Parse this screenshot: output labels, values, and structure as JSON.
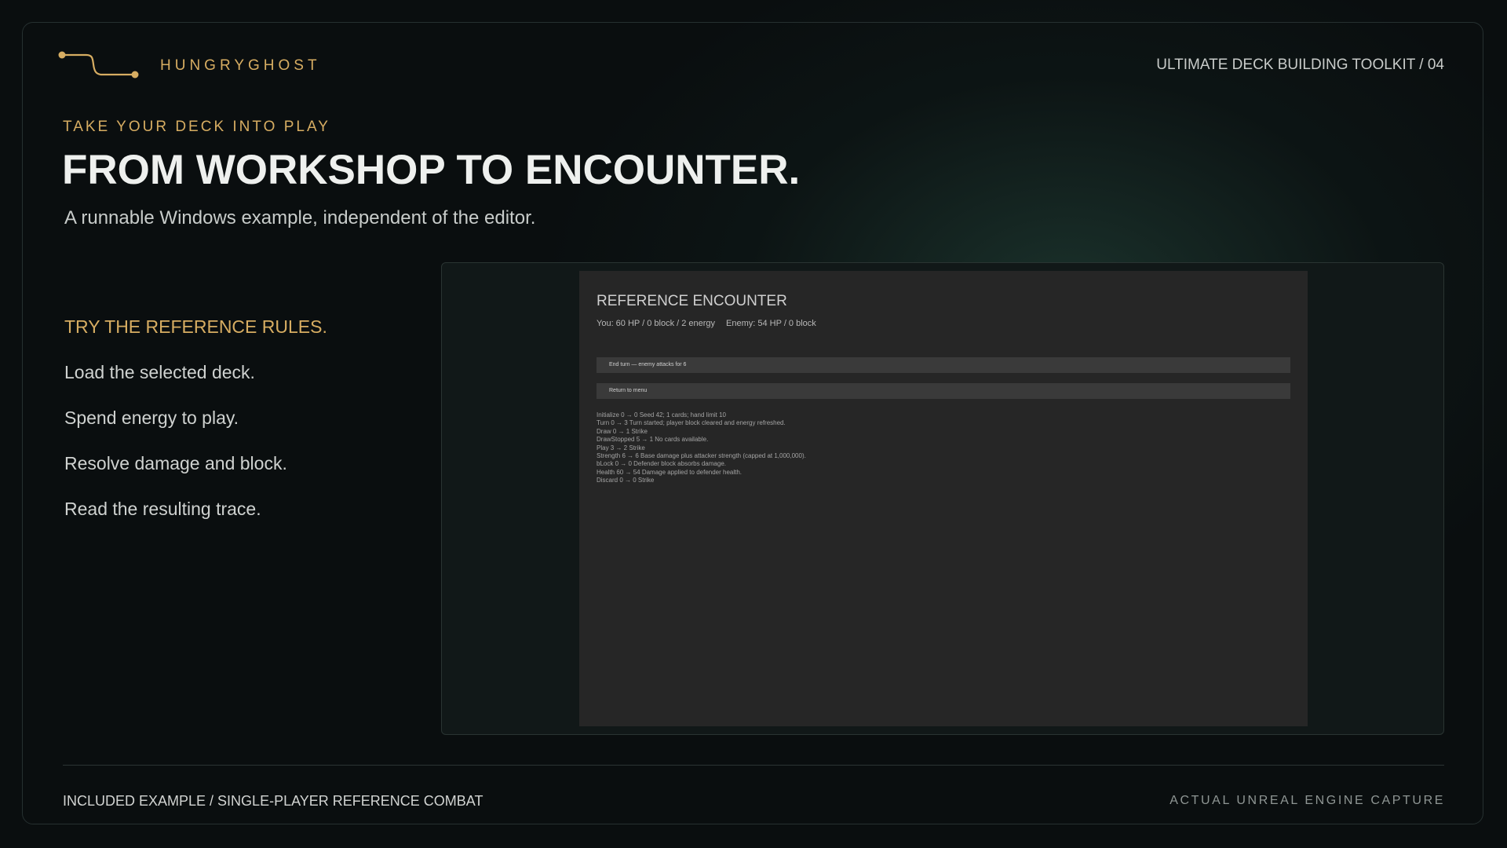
{
  "brand": {
    "name": "HUNGRYGHOST",
    "logo_icon": "connector-line-icon",
    "accent": "#d7ad62"
  },
  "header": {
    "deck_ref": "ULTIMATE DECK BUILDING TOOLKIT / 04"
  },
  "hero": {
    "eyebrow": "TAKE YOUR DECK INTO PLAY",
    "title": "FROM WORKSHOP TO ENCOUNTER.",
    "subtitle": "A runnable Windows example, independent of the editor."
  },
  "steps": {
    "title": "TRY THE REFERENCE RULES.",
    "items": [
      "Load the selected deck.",
      "Spend energy to play.",
      "Resolve damage and block.",
      "Read the resulting trace."
    ]
  },
  "encounter": {
    "title": "REFERENCE ENCOUNTER",
    "player_stats": "You: 60 HP  /  0 block  /  2 energy",
    "enemy_stats": "Enemy: 54 HP  /  0 block",
    "end_turn_button": "End turn — enemy attacks for 6",
    "return_button": "Return to menu",
    "trace": [
      "Initialize  0 → 0  Seed 42; 1 cards; hand limit 10",
      "Turn  0 → 3  Turn started; player block cleared and energy refreshed.",
      "Draw  0 → 1  Strike",
      "DrawStopped  5 → 1  No cards available.",
      "Play  3 → 2  Strike",
      "Strength  6 → 6  Base damage plus attacker strength (capped at 1,000,000).",
      "bLock  0 → 0  Defender block absorbs damage.",
      "Health  60 → 54  Damage applied to defender health.",
      "Discard  0 → 0  Strike"
    ]
  },
  "footer": {
    "left": "INCLUDED EXAMPLE / SINGLE-PLAYER REFERENCE COMBAT",
    "right": "ACTUAL UNREAL ENGINE CAPTURE"
  }
}
